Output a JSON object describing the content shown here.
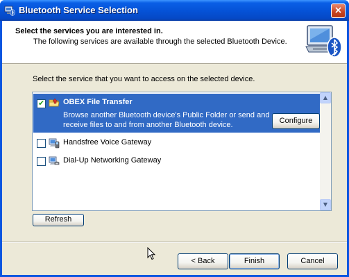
{
  "window": {
    "title": "Bluetooth Service Selection",
    "close_glyph": "×"
  },
  "header": {
    "title": "Select the services you are interested in.",
    "subtitle": "The following services are available through the selected Bluetooth Device.",
    "icon": "bluetooth-computer-icon"
  },
  "prompt": "Select the service that you want to access on the selected device.",
  "services": [
    {
      "label": "OBEX File Transfer",
      "checked": true,
      "selected": true,
      "icon": "obex-folder-icon",
      "description": "Browse another Bluetooth device's Public Folder or send and receive files to and from another Bluetooth device.",
      "configure_label": "Configure"
    },
    {
      "label": "Handsfree Voice Gateway",
      "checked": false,
      "selected": false,
      "icon": "handsfree-icon"
    },
    {
      "label": "Dial-Up Networking Gateway",
      "checked": false,
      "selected": false,
      "icon": "dialup-icon"
    }
  ],
  "buttons": {
    "refresh": "Refresh",
    "back": "< Back",
    "finish": "Finish",
    "cancel": "Cancel"
  },
  "scrollbar": {
    "up_glyph": "▲",
    "down_glyph": "▼"
  },
  "checkmark_glyph": "✔",
  "colors": {
    "title_bar": "#0553d8",
    "selection": "#316ac5",
    "dialog_face": "#ece9d8"
  }
}
